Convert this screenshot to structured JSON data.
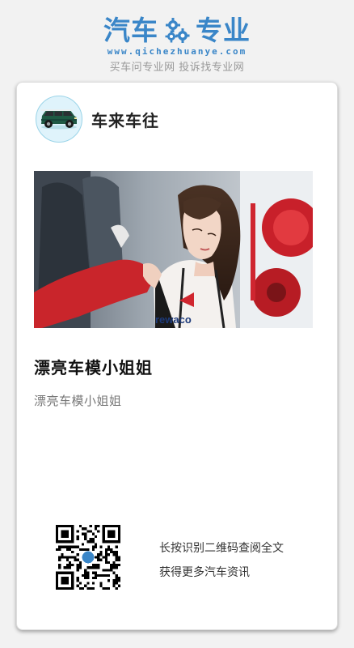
{
  "header": {
    "logo_left": "汽车",
    "logo_right": "专业",
    "logo_icon": "gear-icon",
    "domain": "www.qichezhuanye.com",
    "slogan": "买车问专业网 投诉找专业网",
    "brand_color": "#3a86c8"
  },
  "card": {
    "channel": {
      "name": "车来车往",
      "avatar_icon": "car-icon"
    },
    "photo": {
      "description_icon": "photo-image"
    },
    "article": {
      "title": "漂亮车模小姐姐",
      "summary": "漂亮车模小姐姐"
    },
    "qr": {
      "line1": "长按识别二维码查阅全文",
      "line2": "获得更多汽车资讯"
    }
  }
}
